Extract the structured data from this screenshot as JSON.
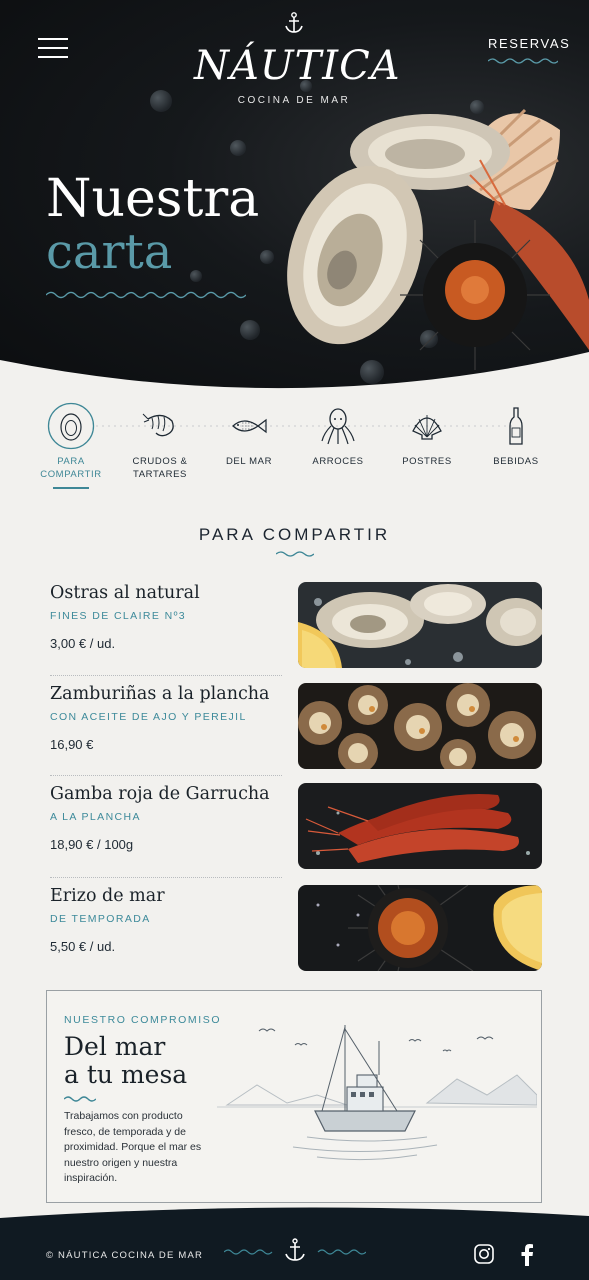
{
  "header": {
    "logo": "NÁUTICA",
    "logo_sub": "COCINA DE MAR",
    "reservas": "RESERVAS"
  },
  "hero": {
    "title_line1": "Nuestra",
    "title_line2": "carta"
  },
  "categories": [
    {
      "label": "PARA\nCOMPARTIR",
      "icon": "oyster-icon",
      "active": true
    },
    {
      "label": "CRUDOS &\nTARTARES",
      "icon": "shrimp-icon",
      "active": false
    },
    {
      "label": "DEL MAR",
      "icon": "fish-icon",
      "active": false
    },
    {
      "label": "ARROCES",
      "icon": "octopus-icon",
      "active": false
    },
    {
      "label": "POSTRES",
      "icon": "shell-icon",
      "active": false
    },
    {
      "label": "BEBIDAS",
      "icon": "bottle-icon",
      "active": false
    }
  ],
  "section": {
    "title": "PARA COMPARTIR"
  },
  "items": [
    {
      "name": "Ostras al natural",
      "desc": "FINES DE CLAIRE Nº3",
      "price": "3,00 €  / ud."
    },
    {
      "name": "Zamburiñas a la plancha",
      "desc": "CON ACEITE DE AJO Y PEREJIL",
      "price": "16,90 €"
    },
    {
      "name": "Gamba roja de Garrucha",
      "desc": "A LA PLANCHA",
      "price": "18,90 €  / 100g"
    },
    {
      "name": "Erizo de mar",
      "desc": "DE TEMPORADA",
      "price": "5,50 €  / ud."
    }
  ],
  "commitment": {
    "kicker": "NUESTRO COMPROMISO",
    "title_line1": "Del mar",
    "title_line2": "a tu mesa",
    "body": "Trabajamos con producto fresco, de temporada y de proximidad. Porque el mar es nuestro origen y nuestra inspiración."
  },
  "footer": {
    "copyright": "© NÁUTICA COCINA DE MAR"
  },
  "colors": {
    "accent": "#3e8796",
    "hero_bg": "#0f1214",
    "footer_bg": "#101a22",
    "paper": "#f2f1ee"
  }
}
